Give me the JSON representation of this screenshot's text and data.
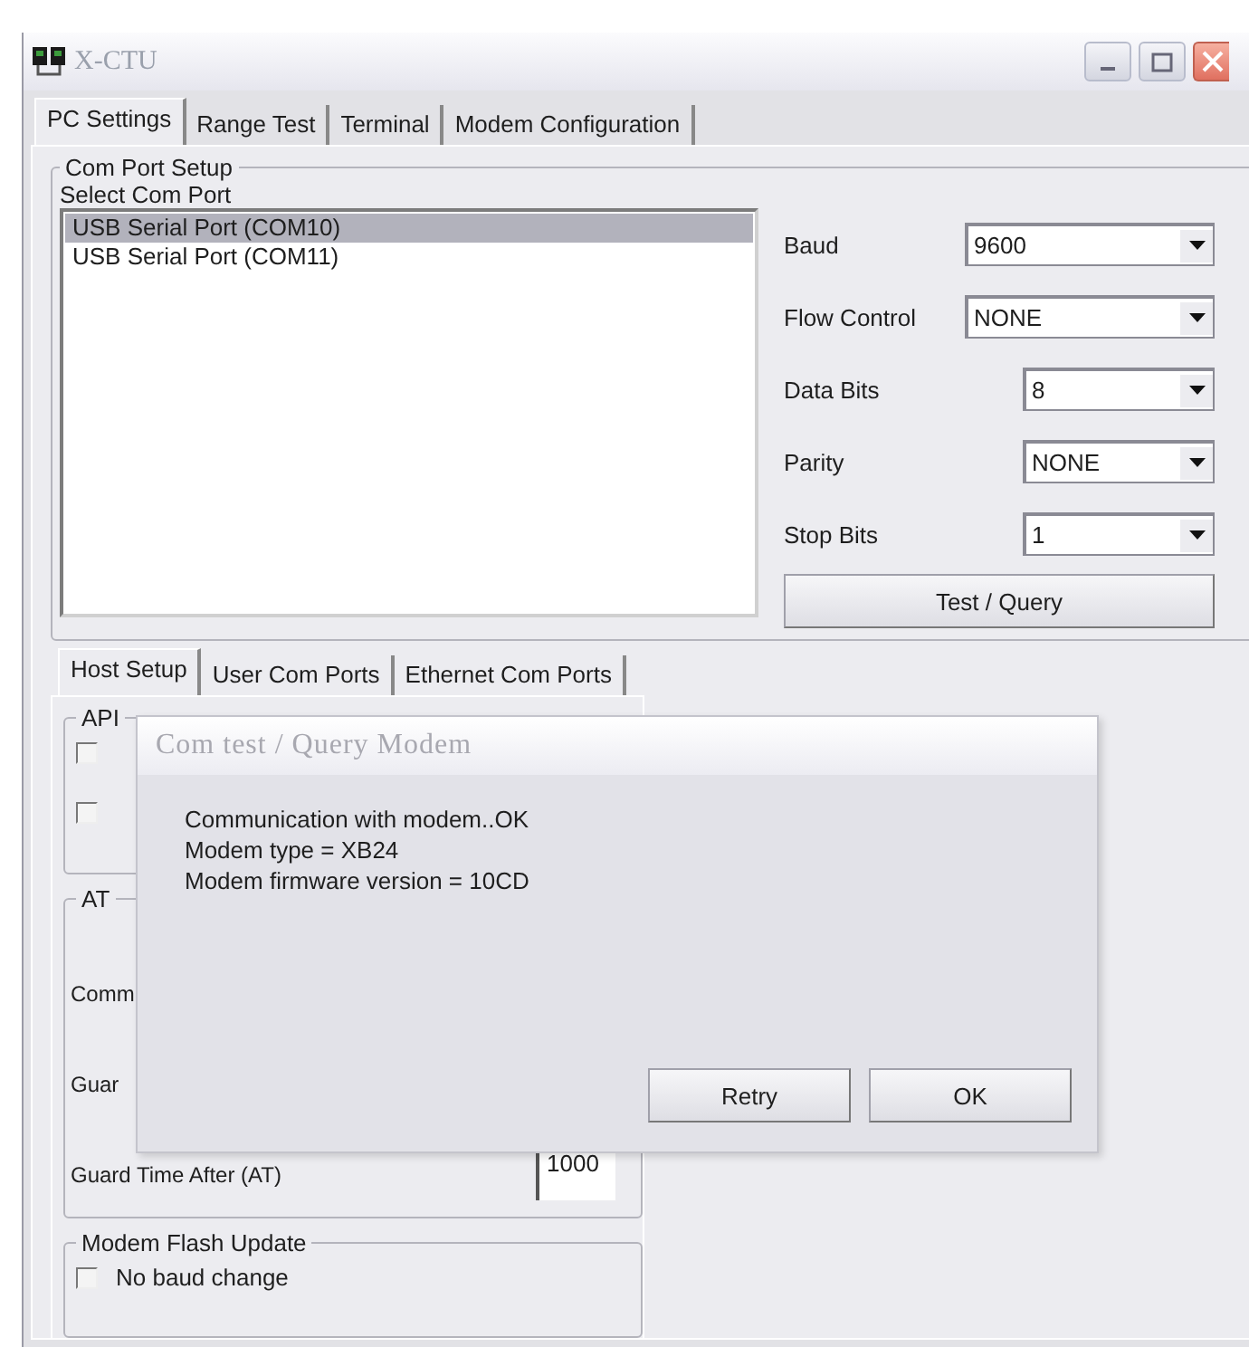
{
  "window": {
    "title": "X-CTU"
  },
  "tabs": [
    {
      "label": "PC Settings",
      "selected": true
    },
    {
      "label": "Range Test",
      "selected": false
    },
    {
      "label": "Terminal",
      "selected": false
    },
    {
      "label": "Modem Configuration",
      "selected": false
    }
  ],
  "com_port_setup": {
    "title": "Com Port Setup",
    "select_label": "Select Com Port",
    "ports": [
      {
        "label": "USB Serial Port (COM10)",
        "selected": true
      },
      {
        "label": "USB Serial Port (COM11)",
        "selected": false
      }
    ],
    "settings": [
      {
        "label": "Baud",
        "value": "9600",
        "kind": "wide"
      },
      {
        "label": "Flow Control",
        "value": "NONE",
        "kind": "wide"
      },
      {
        "label": "Data Bits",
        "value": "8",
        "kind": "narrow"
      },
      {
        "label": "Parity",
        "value": "NONE",
        "kind": "narrow"
      },
      {
        "label": "Stop Bits",
        "value": "1",
        "kind": "narrow"
      }
    ],
    "test_button": "Test  / Query"
  },
  "host_tabs": [
    {
      "label": "Host Setup",
      "selected": true
    },
    {
      "label": "User Com Ports",
      "selected": false
    },
    {
      "label": "Ethernet Com Ports",
      "selected": false
    }
  ],
  "api_group": {
    "title": "API",
    "checkboxes": [
      {
        "checked": false
      },
      {
        "checked": false
      }
    ]
  },
  "at_group": {
    "title": "AT",
    "rows": [
      {
        "label": "Comm"
      },
      {
        "label": "Guar"
      },
      {
        "label": "Guard Time After (AT)",
        "value": "1000"
      }
    ]
  },
  "flash_group": {
    "title": "Modem Flash Update",
    "checkboxes": [
      {
        "label": "No baud change",
        "checked": false
      }
    ]
  },
  "dialog": {
    "title": "Com test / Query Modem",
    "lines": [
      "Communication with modem..OK",
      "Modem type = XB24",
      "Modem firmware version = 10CD"
    ],
    "buttons": [
      "Retry",
      "OK"
    ]
  }
}
